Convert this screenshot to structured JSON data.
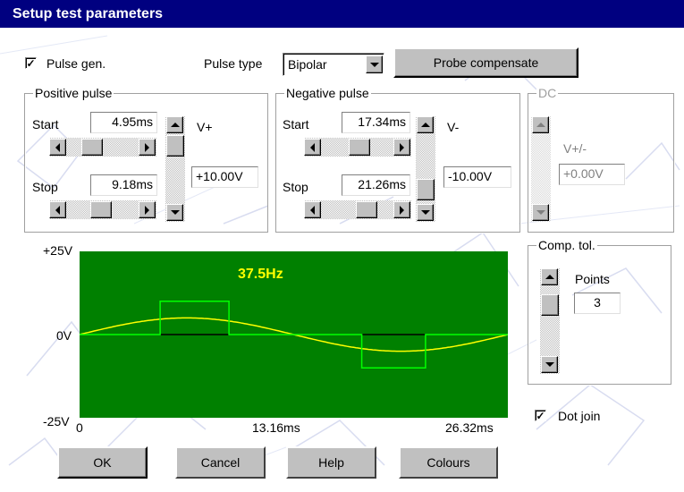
{
  "window": {
    "title": "Setup test parameters"
  },
  "pulse_gen": {
    "label": "Pulse gen.",
    "checked": true,
    "mark": "✓"
  },
  "pulse_type": {
    "label": "Pulse type",
    "value": "Bipolar"
  },
  "probe_button": "Probe compensate",
  "positive_pulse": {
    "title": "Positive pulse",
    "start_label": "Start",
    "start_value": "4.95ms",
    "stop_label": "Stop",
    "stop_value": "9.18ms",
    "volt_label": "V+",
    "volt_value": "+10.00V"
  },
  "negative_pulse": {
    "title": "Negative pulse",
    "start_label": "Start",
    "start_value": "17.34ms",
    "stop_label": "Stop",
    "stop_value": "21.26ms",
    "volt_label": "V-",
    "volt_value": "-10.00V"
  },
  "dc": {
    "title": "DC",
    "volt_label": "V+/-",
    "volt_value": "+0.00V"
  },
  "comp_tol": {
    "title": "Comp. tol.",
    "points_label": "Points",
    "points_value": "3"
  },
  "dot_join": {
    "label": "Dot join",
    "checked": true,
    "mark": "✓"
  },
  "scope": {
    "frequency": "37.5Hz",
    "y_top": "+25V",
    "y_mid": "0V",
    "y_bottom": "-25V",
    "x_left": "0",
    "x_mid": "13.16ms",
    "x_right": "26.32ms",
    "bg_color": "#008000",
    "sine_color": "#ffff00",
    "pulse_color": "#00ff00",
    "freq_color": "#ffff00"
  },
  "chart_data": {
    "type": "line",
    "xlim": [
      0,
      26.32
    ],
    "ylim": [
      -25,
      25
    ],
    "series": [
      {
        "name": "sine",
        "amplitude": 5,
        "cycles": 1
      },
      {
        "name": "pulse",
        "points": [
          [
            0,
            0
          ],
          [
            4.95,
            0
          ],
          [
            4.95,
            10
          ],
          [
            9.18,
            10
          ],
          [
            9.18,
            0
          ],
          [
            17.34,
            0
          ],
          [
            17.34,
            -10
          ],
          [
            21.26,
            -10
          ],
          [
            21.26,
            0
          ],
          [
            26.32,
            0
          ]
        ]
      }
    ]
  },
  "buttons": {
    "ok": "OK",
    "cancel": "Cancel",
    "help": "Help",
    "colours": "Colours"
  }
}
